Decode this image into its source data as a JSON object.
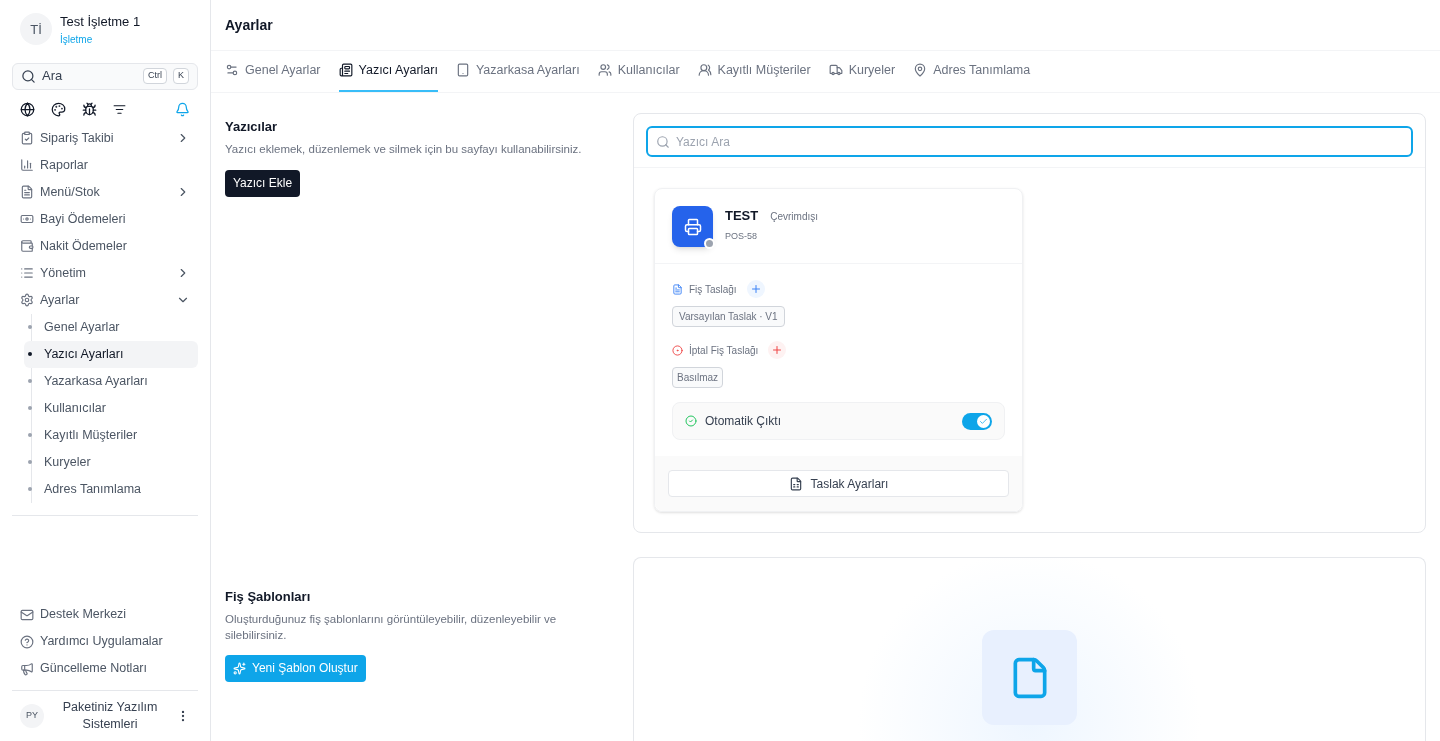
{
  "business": {
    "initials": "Tİ",
    "name": "Test İşletme 1",
    "role": "İşletme"
  },
  "search": {
    "placeholder": "Ara",
    "keys": [
      "Ctrl",
      "K"
    ]
  },
  "nav": [
    {
      "label": "Sipariş Takibi",
      "expanded": false
    },
    {
      "label": "Raporlar"
    },
    {
      "label": "Menü/Stok",
      "expanded": false
    },
    {
      "label": "Bayi Ödemeleri"
    },
    {
      "label": "Nakit Ödemeler"
    },
    {
      "label": "Yönetim",
      "expanded": false
    },
    {
      "label": "Ayarlar",
      "expanded": true,
      "children": [
        {
          "label": "Genel Ayarlar",
          "selected": false
        },
        {
          "label": "Yazıcı Ayarları",
          "selected": true
        },
        {
          "label": "Yazarkasa Ayarları",
          "selected": false
        },
        {
          "label": "Kullanıcılar",
          "selected": false
        },
        {
          "label": "Kayıtlı Müşteriler",
          "selected": false
        },
        {
          "label": "Kuryeler",
          "selected": false
        },
        {
          "label": "Adres Tanımlama",
          "selected": false
        }
      ]
    }
  ],
  "footer_links": [
    "Destek Merkezi",
    "Yardımcı Uygulamalar",
    "Güncelleme Notları"
  ],
  "account": {
    "initials": "PY",
    "name": "Paketiniz Yazılım Sistemleri"
  },
  "page_title": "Ayarlar",
  "tabs": [
    {
      "label": "Genel Ayarlar",
      "selected": false
    },
    {
      "label": "Yazıcı Ayarları",
      "selected": true
    },
    {
      "label": "Yazarkasa Ayarları",
      "selected": false
    },
    {
      "label": "Kullanıcılar",
      "selected": false
    },
    {
      "label": "Kayıtlı Müşteriler",
      "selected": false
    },
    {
      "label": "Kuryeler",
      "selected": false
    },
    {
      "label": "Adres Tanımlama",
      "selected": false
    }
  ],
  "printers_section": {
    "title": "Yazıcılar",
    "description": "Yazıcı eklemek, düzenlemek ve silmek için bu sayfayı kullanabilirsiniz.",
    "button": "Yazıcı Ekle",
    "search_placeholder": "Yazıcı Ara"
  },
  "printers": [
    {
      "name": "TEST",
      "status": "Çevrimdışı",
      "online": false,
      "model": "POS-58",
      "receipt_label": "Fiş Taslağı",
      "receipt_value": "Varsayılan Taslak · V1",
      "cancel_label": "İptal Fiş Taslağı",
      "cancel_value": "Basılmaz",
      "auto_label": "Otomatik Çıktı",
      "auto_on": true,
      "settings_button": "Taslak Ayarları"
    }
  ],
  "templates_section": {
    "title": "Fiş Şablonları",
    "description": "Oluşturduğunuz fiş şablonlarını görüntüleyebilir, düzenleyebilir ve silebilirsiniz.",
    "button": "Yeni Şablon Oluştur"
  }
}
